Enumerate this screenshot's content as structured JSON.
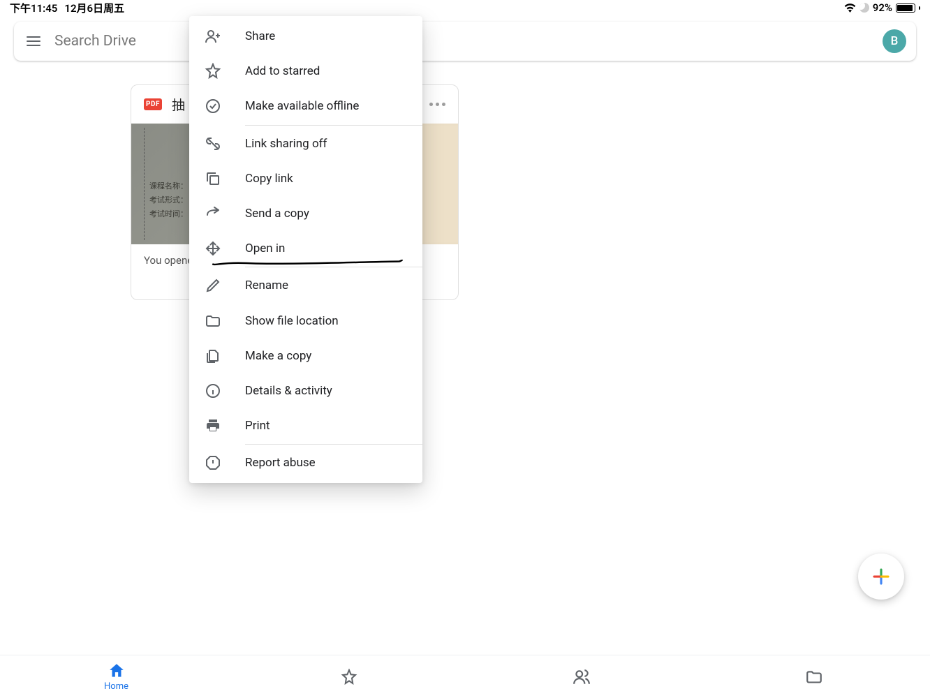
{
  "status_bar": {
    "time": "下午11:45",
    "date": "12月6日周五",
    "battery_pct": "92%"
  },
  "search": {
    "placeholder": "Search Drive",
    "avatar_letter": "B"
  },
  "file_card": {
    "badge": "PDF",
    "title": "抽",
    "preview_lines": [
      "课程名称：",
      "考试形式：",
      "考试时间："
    ],
    "footer": "You opened"
  },
  "context_menu": {
    "items": [
      {
        "icon": "person-add-icon",
        "label": "Share"
      },
      {
        "icon": "star-outline-icon",
        "label": "Add to starred"
      },
      {
        "icon": "offline-check-icon",
        "label": "Make available offline"
      },
      {
        "divider": true
      },
      {
        "icon": "link-off-icon",
        "label": "Link sharing off"
      },
      {
        "icon": "copy-icon",
        "label": "Copy link"
      },
      {
        "icon": "arrow-forward-icon",
        "label": "Send a copy"
      },
      {
        "icon": "move-icon",
        "label": "Open in"
      },
      {
        "divider": true
      },
      {
        "icon": "pencil-icon",
        "label": "Rename"
      },
      {
        "icon": "folder-icon",
        "label": "Show file location"
      },
      {
        "icon": "file-copy-icon",
        "label": "Make a copy"
      },
      {
        "icon": "info-icon",
        "label": "Details & activity"
      },
      {
        "icon": "print-icon",
        "label": "Print"
      },
      {
        "divider": true
      },
      {
        "icon": "report-icon",
        "label": "Report abuse"
      }
    ]
  },
  "bottom_nav": {
    "items": [
      {
        "icon": "home-icon",
        "label": "Home",
        "active": true
      },
      {
        "icon": "star-outline-icon",
        "label": "Starred",
        "active": false
      },
      {
        "icon": "people-icon",
        "label": "Shared",
        "active": false
      },
      {
        "icon": "folder-outline-icon",
        "label": "Files",
        "active": false
      }
    ]
  }
}
